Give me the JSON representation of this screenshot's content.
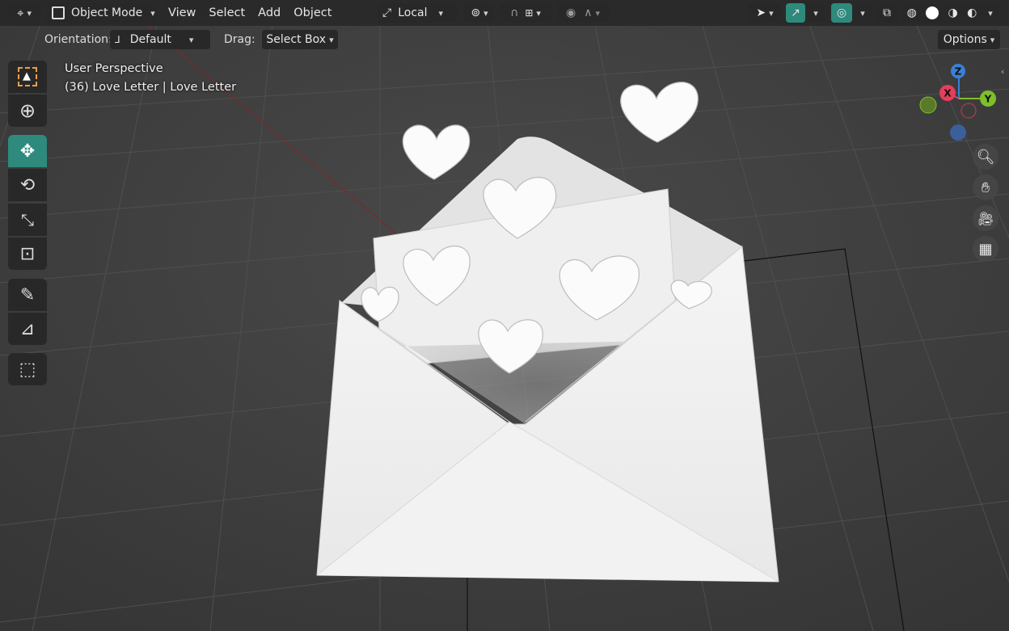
{
  "header": {
    "editor_type_icon": "3d-viewport-icon",
    "mode": {
      "label": "Object Mode",
      "icon": "object-mode-icon"
    },
    "menus": [
      {
        "label": "View"
      },
      {
        "label": "Select"
      },
      {
        "label": "Add"
      },
      {
        "label": "Object"
      }
    ],
    "transform_orientation": {
      "label": "Local",
      "icon": "local-orientation-icon"
    },
    "viewport_shading_icons": [
      "wireframe-shading-icon",
      "solid-shading-icon",
      "material-shading-icon",
      "rendered-shading-icon"
    ],
    "active_shading": "solid"
  },
  "tool_header": {
    "orientation_label": "Orientation:",
    "orientation_value": "Default",
    "drag_label": "Drag:",
    "drag_value": "Select Box",
    "options_label": "Options"
  },
  "toolbar": {
    "tools": [
      {
        "name": "select-box-tool",
        "icon": "select-box-icon",
        "active": false
      },
      {
        "name": "cursor-tool",
        "icon": "cursor-icon",
        "active": false
      },
      {
        "name": "move-tool",
        "icon": "move-icon",
        "active": true
      },
      {
        "name": "rotate-tool",
        "icon": "rotate-icon",
        "active": false
      },
      {
        "name": "scale-tool",
        "icon": "scale-icon",
        "active": false
      },
      {
        "name": "transform-tool",
        "icon": "transform-icon",
        "active": false
      },
      {
        "name": "annotate-tool",
        "icon": "annotate-icon",
        "active": false
      },
      {
        "name": "measure-tool",
        "icon": "measure-icon",
        "active": false
      },
      {
        "name": "add-cube-tool",
        "icon": "add-cube-icon",
        "active": false
      }
    ]
  },
  "viewport_info": {
    "view_name": "User Perspective",
    "object_info": "(36) Love Letter | Love Letter"
  },
  "gizmo": {
    "axes": [
      {
        "label": "Z",
        "color": "#3b7fd4"
      },
      {
        "label": "X",
        "color": "#e0405a"
      },
      {
        "label": "Y",
        "color": "#7fbf2a"
      }
    ]
  },
  "nav_buttons": [
    "zoom-icon",
    "pan-hand-icon",
    "camera-icon",
    "grid-perspective-icon"
  ],
  "colors": {
    "accent": "#2d8a7c",
    "background": "#3d3d3d",
    "header": "#282828"
  }
}
